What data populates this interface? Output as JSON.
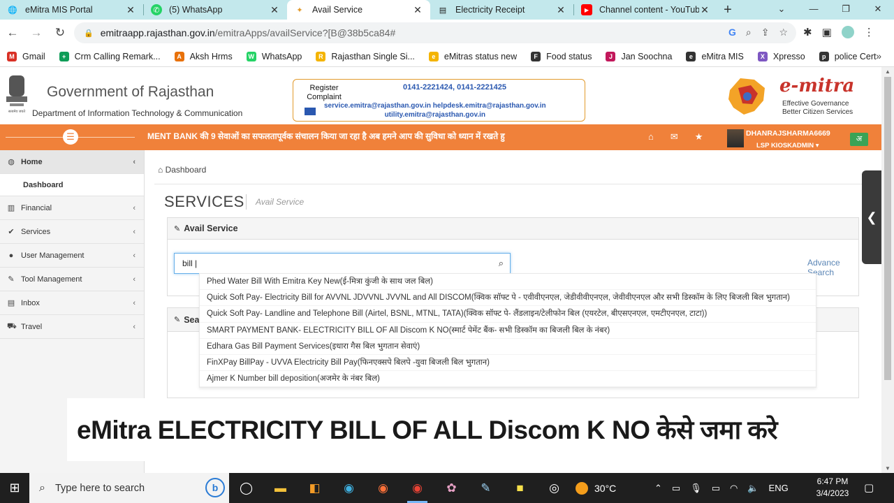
{
  "tabs": [
    {
      "title": "eMitra MIS Portal",
      "icon": "globe-icon"
    },
    {
      "title": "(5) WhatsApp",
      "icon": "whatsapp-icon"
    },
    {
      "title": "Avail Service",
      "icon": "emitra-icon",
      "active": true
    },
    {
      "title": "Electricity Receipt",
      "icon": "document-icon"
    },
    {
      "title": "Channel content - YouTube",
      "icon": "youtube-icon"
    }
  ],
  "address": {
    "domain": "emitraapp.rajasthan.gov.in",
    "path": "/emitraApps/availService?[B@38b5ca84#"
  },
  "bookmarks": [
    {
      "label": "Gmail",
      "color": "#d93025",
      "glyph": "M"
    },
    {
      "label": "Crm Calling Remark...",
      "color": "#0f9d58",
      "glyph": "+"
    },
    {
      "label": "Aksh Hrms",
      "color": "#e8710a",
      "glyph": "A"
    },
    {
      "label": "WhatsApp",
      "color": "#25d366",
      "glyph": "W"
    },
    {
      "label": "Rajasthan Single Si...",
      "color": "#f4b400",
      "glyph": "R"
    },
    {
      "label": "eMitras status new",
      "color": "#f4b400",
      "glyph": "e"
    },
    {
      "label": "Food status",
      "color": "#333333",
      "glyph": "F"
    },
    {
      "label": "Jan Soochna",
      "color": "#c2185b",
      "glyph": "J"
    },
    {
      "label": "eMitra MIS",
      "color": "#333333",
      "glyph": "e"
    },
    {
      "label": "Xpresso",
      "color": "#7e57c2",
      "glyph": "X"
    },
    {
      "label": "police Cert",
      "color": "#333333",
      "glyph": "p"
    }
  ],
  "header": {
    "gov_title": "Government of Rajasthan",
    "dept": "Department of Information Technology & Communication",
    "register_label": "Register Complaint",
    "phones": "0141-2221424, 0141-2221425",
    "emails_line1": "service.emitra@rajasthan.gov.in helpdesk.emitra@rajasthan.gov.in",
    "emails_line2": "utility.emitra@rajasthan.gov.in",
    "brand": "e-mitra",
    "tagline_1": "Effective Governance",
    "tagline_2": "Better Citizen Services"
  },
  "topbar": {
    "marquee": "MENT BANK की 9 सेवाओं का सफलतापूर्वक संचालन किया जा रहा है अब हमने आप की सुविधा को ध्यान में रखते हु",
    "user_name": "DHANRAJSHARMA6669",
    "user_role": "LSP KIOSKADMIN ▾",
    "lang": "अ"
  },
  "sidebar": {
    "home": "Home",
    "dashboard": "Dashboard",
    "items": [
      {
        "label": "Financial",
        "icon": "money-icon"
      },
      {
        "label": "Services",
        "icon": "check-circle-icon"
      },
      {
        "label": "User Management",
        "icon": "user-icon"
      },
      {
        "label": "Tool Management",
        "icon": "wrench-icon"
      },
      {
        "label": "Inbox",
        "icon": "inbox-icon"
      },
      {
        "label": "Travel",
        "icon": "car-icon"
      }
    ]
  },
  "main": {
    "breadcrumb": "Dashboard",
    "heading": "SERVICES",
    "subheading": "Avail Service",
    "panel_title": "Avail Service",
    "search_value": "bill |",
    "advance_search": "Advance Search",
    "panel2_title": "Sea"
  },
  "suggestions": [
    "Phed Water Bill With Emitra Key New(ई-मित्रा कुंजी के साथ जल बिल)",
    "Quick Soft Pay- Electricity Bill for AVVNL JDVVNL JVVNL and All DISCOM(क्विक सॉफ्ट पे - एवीवीएनएल, जेडीवीवीएनएल, जेवीवीएनएल और सभी डिस्कॉम के लिए बिजली बिल भुगतान)",
    "Quick Soft Pay- Landline and Telephone Bill (Airtel, BSNL, MTNL, TATA)(क्विक सॉफ्ट पे- लैंडलाइन/टेलीफोन बिल (एयरटेल, बीएसएनएल, एमटीएनएल, टाटा))",
    "SMART PAYMENT BANK- ELECTRICITY BILL OF All Discom K NO(स्मार्ट पेमेंट बैंक- सभी डिस्कॉम का बिजली बिल के नंबर)",
    "Edhara Gas Bill Payment Services(इधारा गैस बिल भुगतान सेवाएं)",
    "FinXPay BillPay - UVVA Electricity Bill Pay(फिनएक्सपे बिलपे -युवा बिजली बिल भुगतान)",
    "Ajmer K Number bill deposition(अजमेर के नंबर बिल)"
  ],
  "overlay": {
    "text": "eMitra ELECTRICITY BILL OF ALL Discom K NO केसे जमा करे"
  },
  "taskbar": {
    "search_placeholder": "Type here to search",
    "temperature": "30°C",
    "lang": "ENG",
    "time": "6:47 PM",
    "date": "3/4/2023"
  },
  "colors": {
    "orange_bar": "#f0813a",
    "link_blue": "#2a58b0",
    "brand_red": "#c8332b"
  }
}
